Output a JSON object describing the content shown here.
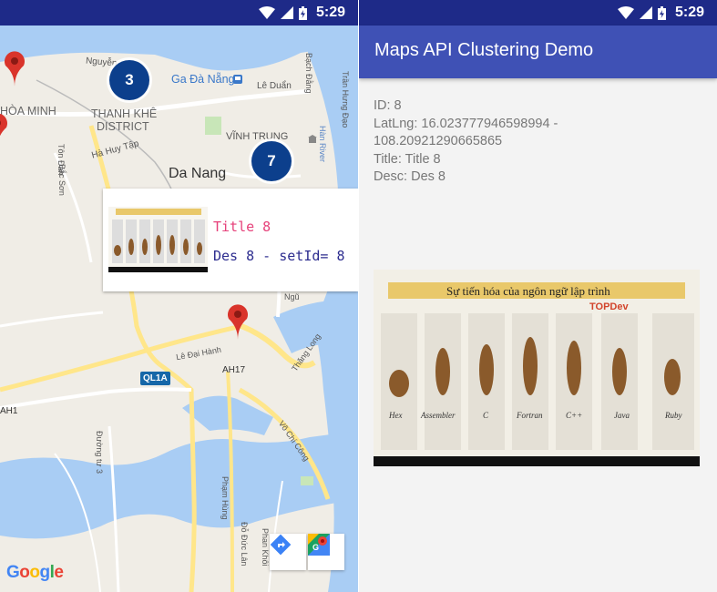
{
  "status_bar": {
    "time": "5:29"
  },
  "map": {
    "labels": {
      "nguyen": "Nguyễn",
      "ga_da_nang": "Ga Đà Nẵng",
      "le_duan": "Lê Duẩn",
      "hoa_minh": "HÒA MINH",
      "thanh_khe_1": "THANH KHÊ",
      "thanh_khe_2": "DISTRICT",
      "vinh_trung": "VĨNH TRUNG",
      "ton_dan": "Tôn Đản",
      "bac_son": "Bắc Sơn",
      "ha_huy_tap": "Hà Huy Tập",
      "da_nang": "Da Nang",
      "bach_dang": "Bạch Đằng",
      "tran_hung_dao": "Trần Hưng Đạo",
      "han_river": "Hàn River",
      "le_dai_hanh": "Lê Đại Hành",
      "ah17": "AH17",
      "thang_long": "Thăng Long",
      "ah1": "AH1",
      "duong_tu": "Đường tư 3",
      "vo_chi_cong": "Võ Chí Công",
      "pham_hung": "Phạm Hùng",
      "do_duc_lan": "Đỗ Đức Lân",
      "phan_khoi": "Phan Khôi",
      "ngu": "Ngũ"
    },
    "road_badge": "QL1A",
    "clusters": [
      {
        "count": "3"
      },
      {
        "count": "7"
      }
    ],
    "info_window": {
      "title": "Title 8",
      "snippet": "Des 8 - setId= 8"
    },
    "attribution": "Google",
    "icons": [
      "directions-icon",
      "google-maps-icon"
    ]
  },
  "app": {
    "title": "Maps API Clustering Demo",
    "details": {
      "id": "ID: 8",
      "latlng_1": "LatLng: 16.023777946598994 -",
      "latlng_2": "108.20921290665865",
      "title": "Title: Title 8",
      "desc": "Desc: Des 8"
    },
    "image": {
      "heading": "Sự tiến hóa của ngôn ngữ lập trình",
      "brand": "TOPDev",
      "stages": [
        "Hex",
        "Assembler",
        "C",
        "Fortran",
        "C++",
        "Java",
        "Ruby"
      ]
    }
  },
  "colors": {
    "status_bar": "#1e2a88",
    "app_bar": "#3f51b5",
    "cluster": "#0c3f8c",
    "marker": "#d9342b",
    "info_title": "#e6417a",
    "info_snippet": "#2d2d8f"
  }
}
